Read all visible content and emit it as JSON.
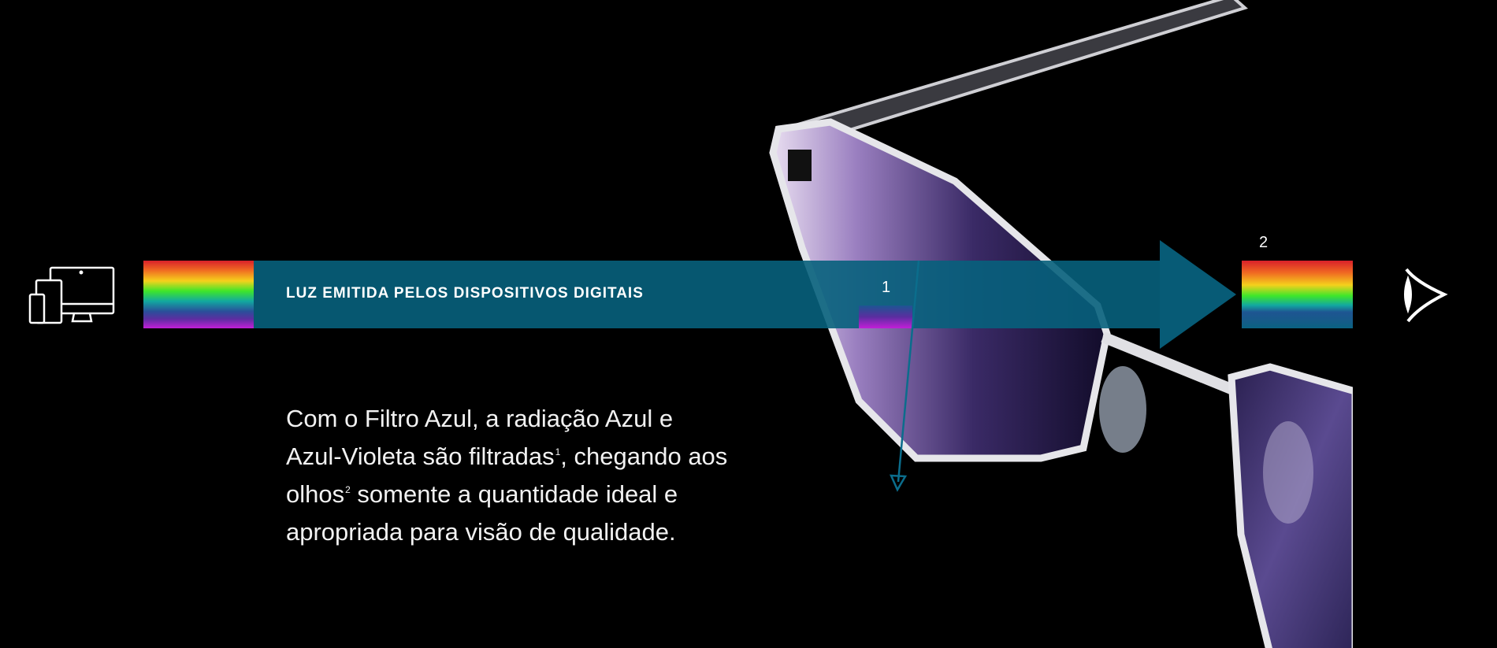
{
  "banner": {
    "label": "LUZ EMITIDA PELOS DISPOSITIVOS DIGITAIS",
    "accent_color": "#07607c"
  },
  "markers": {
    "filtered": "1",
    "eyes": "2"
  },
  "paragraph": {
    "line1": "Com o Filtro Azul, a radiação Azul e",
    "line2a": "Azul-Violeta são filtradas",
    "sup1": "1",
    "line2b": ", chegando aos",
    "line3a": "olhos",
    "sup2": "2",
    "line3b": " somente a quantidade ideal e",
    "line4": "apropriada para visão de qualidade."
  },
  "icons": {
    "source": "devices-icon",
    "target": "eye-icon"
  }
}
